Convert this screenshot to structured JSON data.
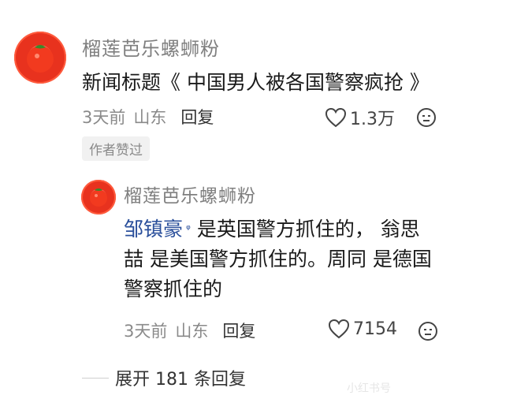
{
  "comment": {
    "username": "榴莲芭乐螺蛳粉",
    "text": "新闻标题《 中国男人被各国警察疯抢 》",
    "time": "3天前",
    "location": "山东",
    "reply_label": "回复",
    "likes": "1.3万",
    "badge": "作者赞过"
  },
  "reply": {
    "username": "榴莲芭乐螺蛳粉",
    "mention": "邹镇豪",
    "text": "是英国警方抓住的， 翁思喆 是美国警方抓住的。周同 是德国警察抓住的",
    "time": "3天前",
    "location": "山东",
    "reply_label": "回复",
    "likes": "7154"
  },
  "expand_label": "展开 181 条回复",
  "watermark": "小红书号"
}
